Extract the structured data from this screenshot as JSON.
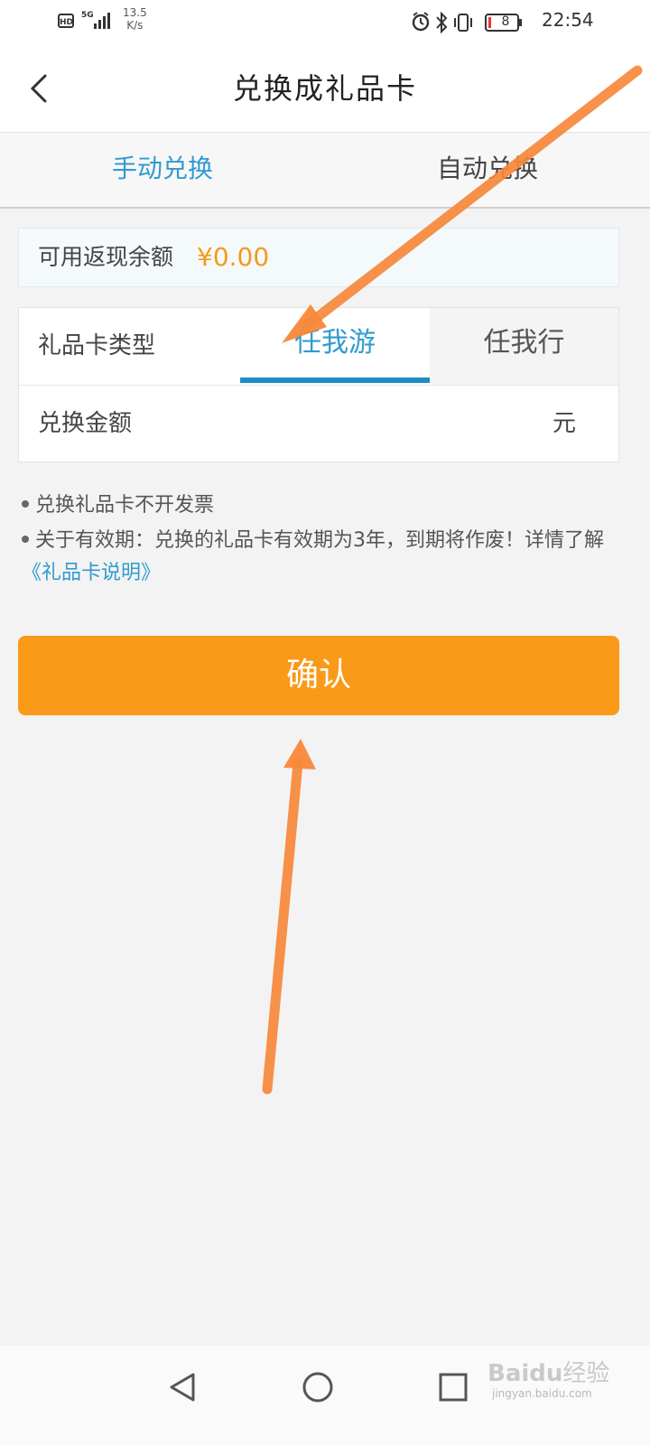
{
  "status_bar": {
    "hd": "HD",
    "network": "5G",
    "speed_value": "13.5",
    "speed_unit": "K/s",
    "battery": "8",
    "time": "22:54"
  },
  "header": {
    "title": "兑换成礼品卡"
  },
  "tabs": [
    {
      "label": "手动兑换",
      "active": true
    },
    {
      "label": "自动兑换",
      "active": false
    }
  ],
  "balance": {
    "label": "可用返现余额",
    "value": "¥0.00"
  },
  "form": {
    "card_type_label": "礼品卡类型",
    "card_types": [
      "任我游",
      "任我行"
    ],
    "selected_card_type": "任我游",
    "amount_label": "兑换金额",
    "amount_value": "",
    "amount_unit": "元"
  },
  "notes": {
    "line1": "兑换礼品卡不开发票",
    "line2": "关于有效期：兑换的礼品卡有效期为3年，到期将作废！详情了解",
    "link": "《礼品卡说明》"
  },
  "confirm_label": "确认",
  "watermark": {
    "brand": "Bai",
    "brand2": "du",
    "suffix": "经验",
    "url": "jingyan.baidu.com"
  },
  "colors": {
    "accent_blue": "#2f9bd0",
    "accent_orange": "#fa9a18",
    "arrow": "#f8883a"
  },
  "icons": [
    "hd-icon",
    "signal-icon",
    "alarm-icon",
    "bluetooth-icon",
    "vibrate-icon",
    "battery-icon",
    "back-arrow-icon",
    "nav-back-icon",
    "nav-home-icon",
    "nav-recents-icon"
  ]
}
